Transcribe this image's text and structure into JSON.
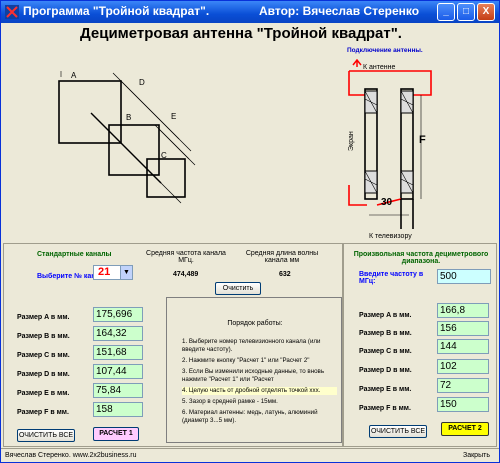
{
  "window": {
    "title": "Программа \"Тройной квадрат\".",
    "author": "Автор: Вячеслав Стеренко",
    "minimize": "_",
    "maximize": "□",
    "close": "X"
  },
  "heading": "Дециметровая антенна \"Тройной квадрат\".",
  "diagram": {
    "labels": [
      "A",
      "B",
      "C",
      "D",
      "E"
    ]
  },
  "connection": {
    "title": "Подключение  антенны.",
    "to_antenna": "К антенне",
    "screen": "Экран",
    "f_label": "F",
    "dim_30": "30",
    "to_tv": "К телевизору"
  },
  "standard": {
    "title": "Стандартные каналы",
    "freq_header": "Средняя частота канала МГц.",
    "wave_header": "Средняя длина волны канала мм",
    "channel_label": "Выберите № канала:",
    "channel_value": "21",
    "freq_value": "474,489",
    "wave_value": "632",
    "clear_button": "Очистить"
  },
  "left_sizes": [
    {
      "label": "Размер A в мм.",
      "value": "175,696"
    },
    {
      "label": "Размер B в мм.",
      "value": "164,32"
    },
    {
      "label": "Размер C в мм.",
      "value": "151,68"
    },
    {
      "label": "Размер D в мм.",
      "value": "107,44"
    },
    {
      "label": "Размер E в мм.",
      "value": "75,84"
    },
    {
      "label": "Размер F в мм.",
      "value": "158"
    }
  ],
  "left_buttons": {
    "clear_all": "ОЧИСТИТЬ ВСЕ",
    "calc1": "РАСЧЕТ 1"
  },
  "procedure": {
    "title": "Порядок работы:",
    "steps": [
      "1. Выберите номер телевизионного канала (или  введите частоту).",
      "2. Нажмите кнопку \"Расчет 1\" или \"Расчет 2\"",
      "3. Если Вы изменили исходные данные, то вновь нажмите \"Расчет 1\" или \"Расчет",
      "4. Целую часть от дробной отделять точкой ххх.",
      "5. Зазор в средней рамке - 15мм.",
      "6. Материал антенны:  медь,  латунь, алюминий (диаметр 3...5 мм)."
    ]
  },
  "custom": {
    "title": "Произвольная частота дециметрового диапазона.",
    "freq_label": "Введите частоту в МГц:",
    "freq_value": "500"
  },
  "right_sizes": [
    {
      "label": "Размер A в мм.",
      "value": "166,8"
    },
    {
      "label": "Размер B в мм.",
      "value": "156"
    },
    {
      "label": "Размер C в мм.",
      "value": "144"
    },
    {
      "label": "Размер D в мм.",
      "value": "102"
    },
    {
      "label": "Размер E в мм.",
      "value": "72"
    },
    {
      "label": "Размер F в мм.",
      "value": "150"
    }
  ],
  "right_buttons": {
    "clear_all": "ОЧИСТИТЬ ВСЕ",
    "calc2": "РАСЧЕТ 2"
  },
  "status": {
    "credits": "Вячеслав Стеренко.   www.2x2business.ru",
    "close": "Закрыть"
  }
}
